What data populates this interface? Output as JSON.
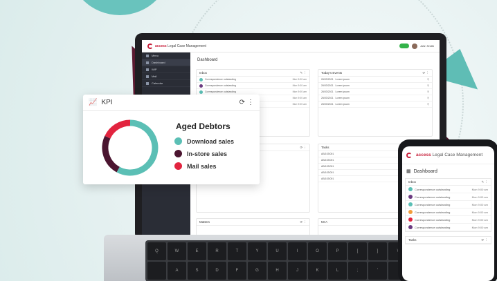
{
  "app": {
    "brand_strong": "access",
    "brand_rest": " Legal Case Management",
    "user": "John Smith"
  },
  "sidebar": {
    "items": [
      "Menu",
      "Dashboard",
      "WIP",
      "Mail",
      "Calendar"
    ]
  },
  "dashboard": {
    "title": "Dashboard"
  },
  "inbox": {
    "title": "Inbox",
    "row_text": "Correspondence outstanding",
    "row_time": "Mon 9:00 am"
  },
  "events": {
    "title": "Today's Events",
    "row_date": "26/03/2021",
    "row_text": "Lorem ipsum"
  },
  "tasks": {
    "title": "Tasks",
    "row_date": "AB/103/001"
  },
  "matters": {
    "title": "Matters"
  },
  "mi": {
    "title": "MI A"
  },
  "kpi": {
    "header": "KPI",
    "title": "Aged Debtors",
    "legend": [
      {
        "label": "Download sales",
        "color": "#5bbfb5"
      },
      {
        "label": "In-store sales",
        "color": "#4b1530"
      },
      {
        "label": "Mail sales",
        "color": "#e2243f"
      }
    ]
  },
  "chart_data": {
    "type": "pie",
    "title": "Aged Debtors",
    "categories": [
      "Download sales",
      "In-store sales",
      "Mail sales"
    ],
    "values": [
      58,
      24,
      18
    ]
  },
  "phone": {
    "dashboard": "Dashboard",
    "inbox": "Inbox",
    "tasks": "Tasks",
    "row_text": "Correspondence outstanding",
    "row_time": "Mon 9:00 am"
  }
}
